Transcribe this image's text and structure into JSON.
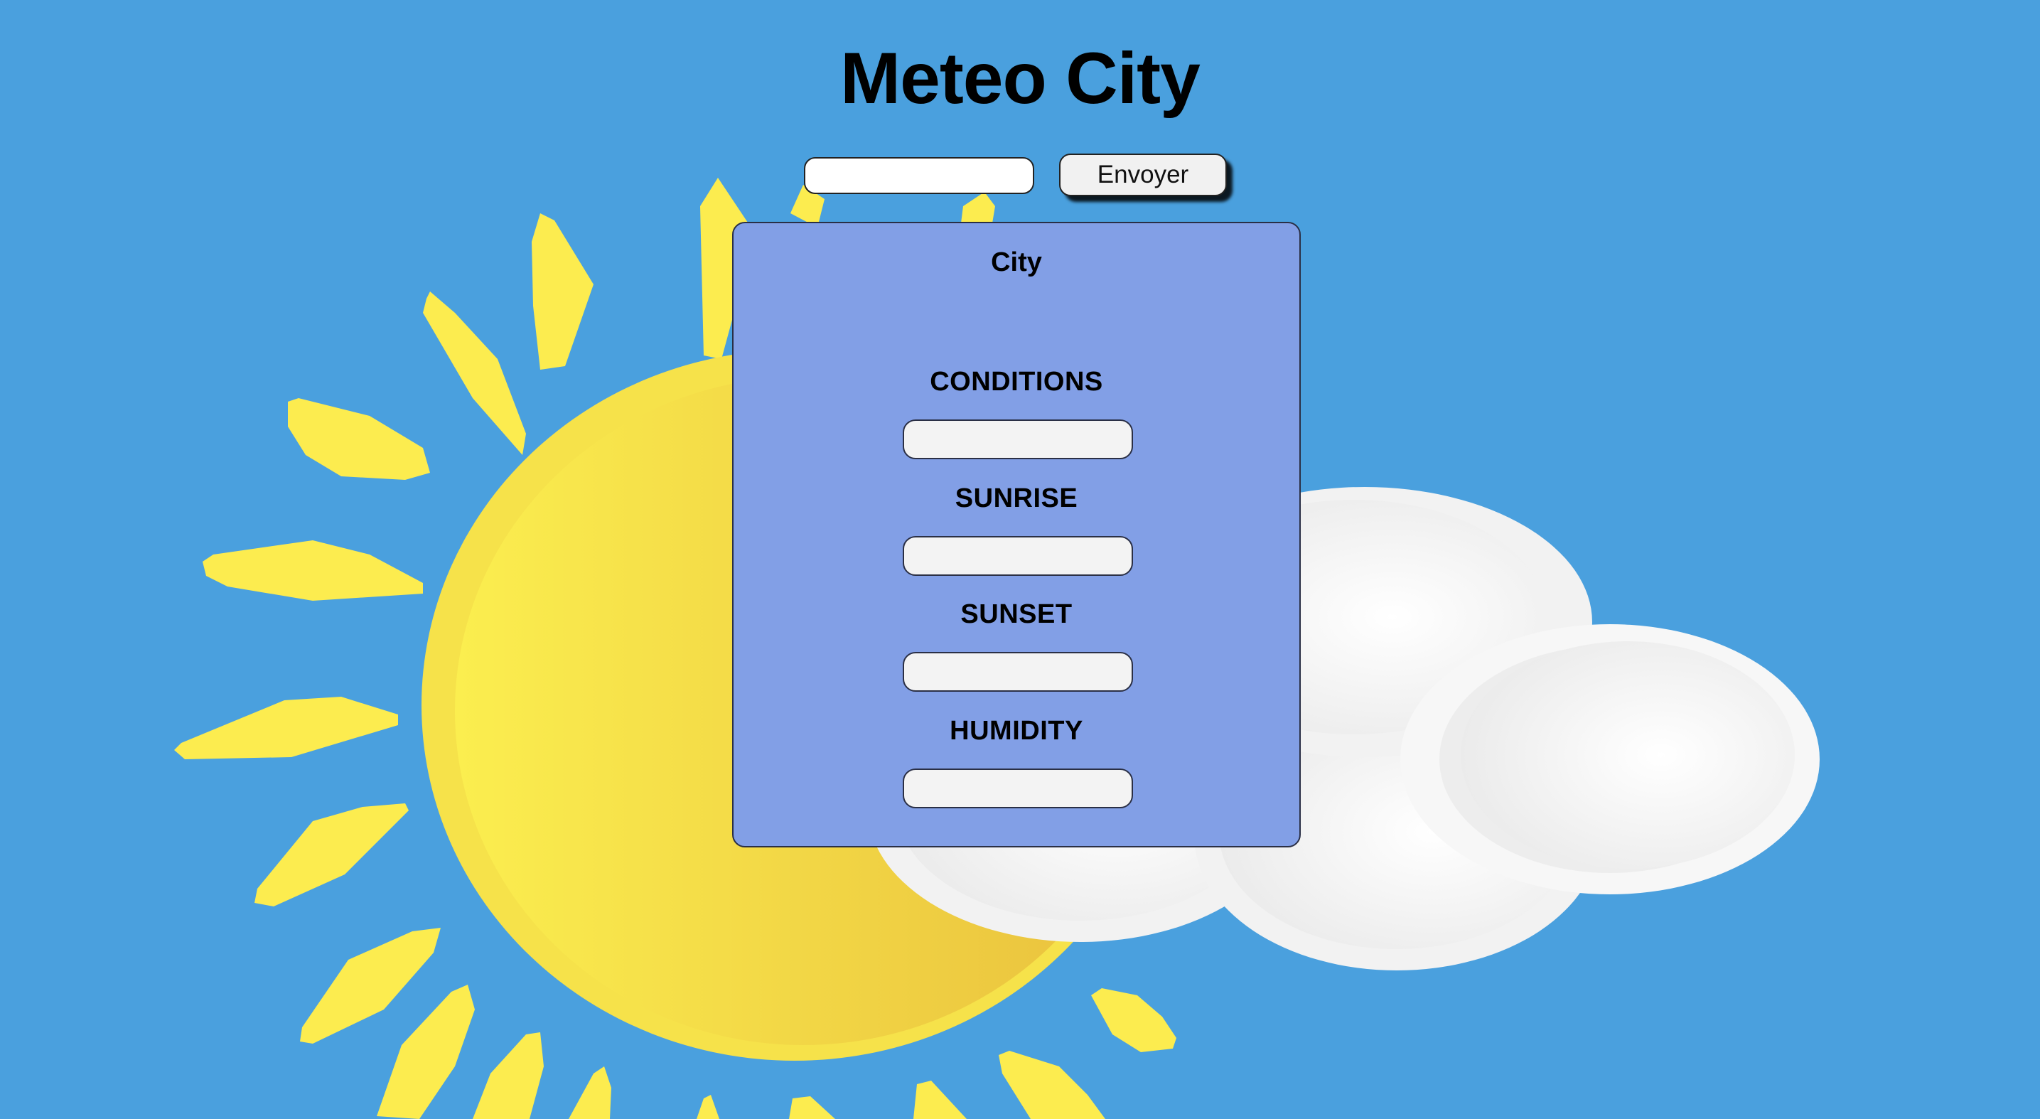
{
  "page": {
    "title": "Meteo City"
  },
  "search": {
    "value": "",
    "placeholder": "",
    "button_label": "Envoyer"
  },
  "card": {
    "city": "City",
    "fields": [
      {
        "label": "CONDITIONS",
        "value": ""
      },
      {
        "label": "SUNRISE",
        "value": ""
      },
      {
        "label": "SUNSET",
        "value": ""
      },
      {
        "label": "HUMIDITY",
        "value": ""
      }
    ]
  },
  "background": {
    "sky_color": "#4aa0de",
    "sun_color": "#f6e24a",
    "cloud_color": "#f4f4f4",
    "sun": "sun-illustration",
    "clouds": "cloud-illustration"
  }
}
